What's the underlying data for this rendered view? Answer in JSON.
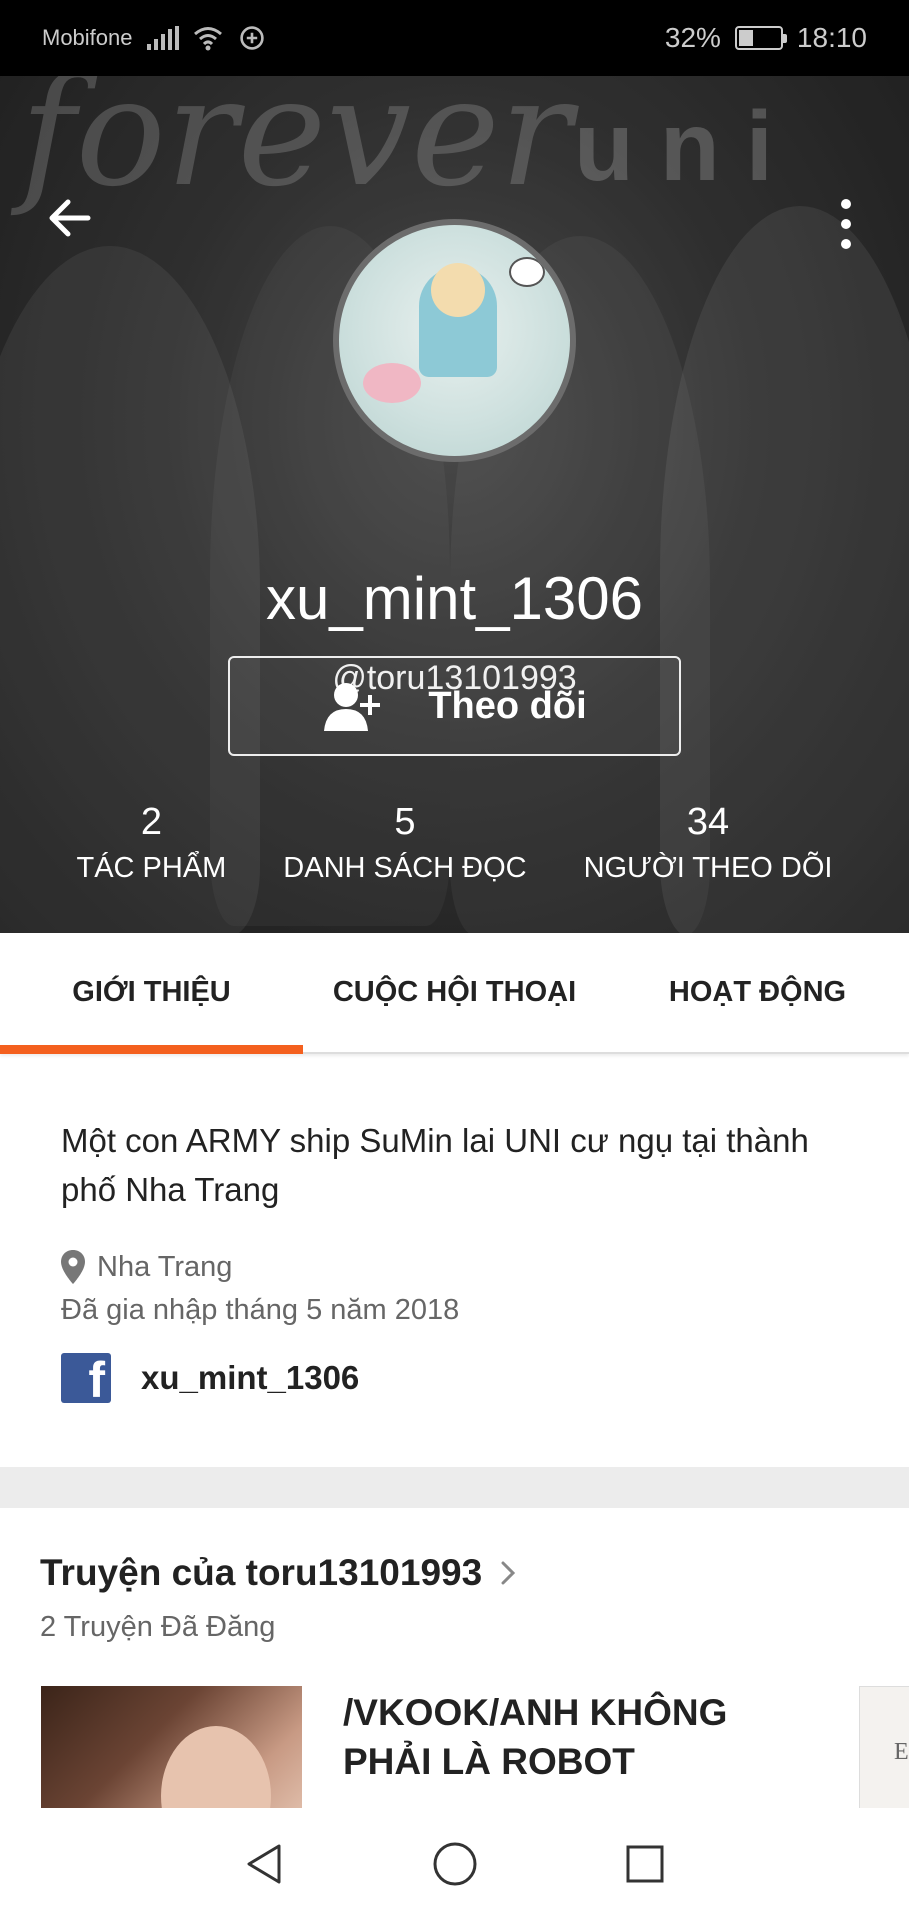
{
  "status_bar": {
    "carrier": "Mobifone",
    "battery_percent_text": "32%",
    "battery_level": 0.32,
    "time": "18:10"
  },
  "header": {
    "watermark": "uni",
    "script_text": "forever",
    "display_name": "xu_mint_1306",
    "username": "@toru13101993",
    "follow_label": "Theo dõi",
    "stats": [
      {
        "value": "2",
        "label": "TÁC PHẨM"
      },
      {
        "value": "5",
        "label": "DANH SÁCH ĐỌC"
      },
      {
        "value": "34",
        "label": "NGƯỜI THEO DÕI"
      }
    ]
  },
  "tabs": [
    {
      "label": "GIỚI THIỆU",
      "active": true
    },
    {
      "label": "CUỘC HỘI THOẠI",
      "active": false
    },
    {
      "label": "HOẠT ĐỘNG",
      "active": false
    }
  ],
  "about": {
    "bio": "Một con ARMY ship SuMin lai UNI cư ngụ tại thành phố Nha Trang",
    "location": "Nha Trang",
    "joined": "Đã gia nhập tháng 5 năm 2018",
    "facebook_name": "xu_mint_1306"
  },
  "stories": {
    "title": "Truyện của toru13101993",
    "count": "2 Truyện Đã Đăng",
    "items": [
      {
        "title": "/VKOOK/ANH KHÔNG PHẢI LÀ ROBOT"
      },
      {
        "title": "En"
      }
    ]
  },
  "colors": {
    "accent": "#f4601e",
    "facebook": "#3b5998",
    "status_bar": "#000000"
  },
  "icons": [
    "back-arrow-icon",
    "more-vert-icon",
    "add-user-icon",
    "location-pin-icon",
    "facebook-icon",
    "chevron-right-icon",
    "nav-back-icon",
    "nav-home-icon",
    "nav-recents-icon"
  ]
}
